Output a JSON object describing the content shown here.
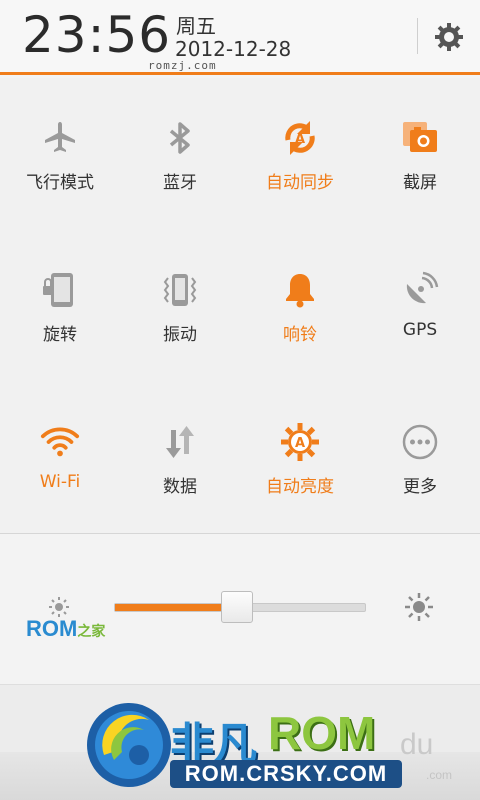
{
  "header": {
    "time": "23:56",
    "weekday": "周五",
    "date": "2012-12-28",
    "watermark": "romzj.com",
    "settings_icon": "gear-icon"
  },
  "toggles": [
    {
      "label": "飞行模式",
      "icon": "airplane-icon",
      "active": false
    },
    {
      "label": "蓝牙",
      "icon": "bluetooth-icon",
      "active": false
    },
    {
      "label": "自动同步",
      "icon": "auto-sync-icon",
      "active": true
    },
    {
      "label": "截屏",
      "icon": "screenshot-icon",
      "active": false
    },
    {
      "label": "旋转",
      "icon": "rotate-lock-icon",
      "active": false
    },
    {
      "label": "振动",
      "icon": "vibrate-icon",
      "active": false
    },
    {
      "label": "响铃",
      "icon": "bell-icon",
      "active": true
    },
    {
      "label": "GPS",
      "icon": "gps-icon",
      "active": false
    },
    {
      "label": "Wi-Fi",
      "icon": "wifi-icon",
      "active": true
    },
    {
      "label": "数据",
      "icon": "data-sync-icon",
      "active": false
    },
    {
      "label": "自动亮度",
      "icon": "auto-brightness-icon",
      "active": true
    },
    {
      "label": "更多",
      "icon": "more-icon",
      "active": false
    }
  ],
  "brightness": {
    "level": 0.49,
    "min_icon": "sun-small-icon",
    "max_icon": "sun-large-icon",
    "logo": {
      "rom": "ROM",
      "suffix": "之家"
    }
  },
  "branding": {
    "title": "非凡",
    "rom": "ROM",
    "url": "ROM.CRSKY.COM",
    "du": "du",
    "com": ".com"
  },
  "colors": {
    "accent": "#f07d1a",
    "inactive_icon": "#9a9a9a",
    "text": "#333333"
  }
}
